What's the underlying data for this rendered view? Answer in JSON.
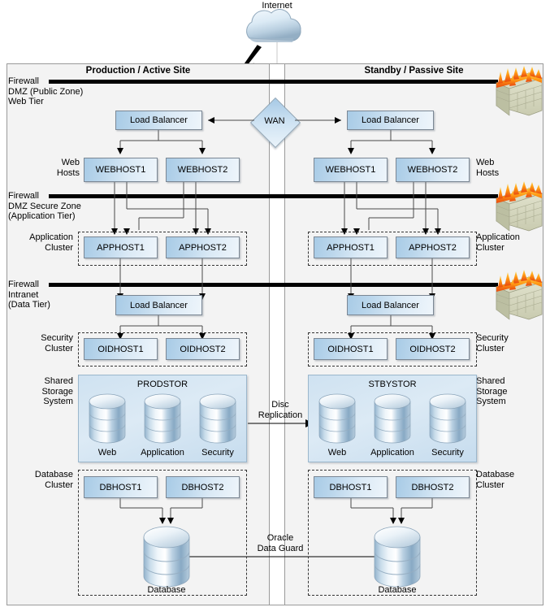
{
  "diagram": {
    "internet_label": "Internet",
    "wan_label": "WAN",
    "sites": [
      {
        "id": "production",
        "title": "Production / Active Site"
      },
      {
        "id": "standby",
        "title": "Standby / Passive Site"
      }
    ],
    "tier_labels_left": [
      {
        "id": "firewall-dmz-public",
        "lines": "Firewall\nDMZ (Public Zone)\nWeb Tier"
      },
      {
        "id": "web-hosts",
        "lines": "Web\nHosts"
      },
      {
        "id": "firewall-dmz-secure",
        "lines": "Firewall\nDMZ Secure Zone\n(Application Tier)"
      },
      {
        "id": "application-cluster",
        "lines": "Application\nCluster"
      },
      {
        "id": "firewall-intranet",
        "lines": "Firewall\nIntranet\n(Data Tier)"
      },
      {
        "id": "security-cluster",
        "lines": "Security\nCluster"
      },
      {
        "id": "shared-storage",
        "lines": "Shared\nStorage\nSystem"
      },
      {
        "id": "database-cluster",
        "lines": "Database\nCluster"
      }
    ],
    "tier_labels_right": [
      {
        "id": "web-hosts",
        "lines": "Web\nHosts"
      },
      {
        "id": "application-cluster",
        "lines": "Application\nCluster"
      },
      {
        "id": "security-cluster",
        "lines": "Security\nCluster"
      },
      {
        "id": "shared-storage",
        "lines": "Shared\nStorage\nSystem"
      },
      {
        "id": "database-cluster",
        "lines": "Database\nCluster"
      }
    ],
    "nodes": {
      "load_balancer": "Load Balancer",
      "webhost1": "WEBHOST1",
      "webhost2": "WEBHOST2",
      "apphost1": "APPHOST1",
      "apphost2": "APPHOST2",
      "oidhost1": "OIDHOST1",
      "oidhost2": "OIDHOST2",
      "dbhost1": "DBHOST1",
      "dbhost2": "DBHOST2",
      "database": "Database"
    },
    "storage": {
      "production_name": "PRODSTOR",
      "standby_name": "STBYSTOR",
      "disks": [
        "Web",
        "Application",
        "Security"
      ]
    },
    "replication": {
      "disc": "Disc\nReplication",
      "dataguard": "Oracle\nData Guard"
    },
    "icons": {
      "firewall": "firewall-brick-flame-icon",
      "cloud": "internet-cloud-icon",
      "lightning": "lightning-bolt-icon",
      "disk": "disk-cylinder-icon",
      "database": "database-cylinder-icon"
    },
    "colors": {
      "node_fill": "#bcd7ec",
      "node_border": "#7b8794",
      "site_bg": "#f3f3f3",
      "frame_border": "#9a9a9a",
      "firewall_bar": "#000000",
      "storage_fill": "#cfe2f1",
      "flame": "#ff9a14"
    }
  }
}
